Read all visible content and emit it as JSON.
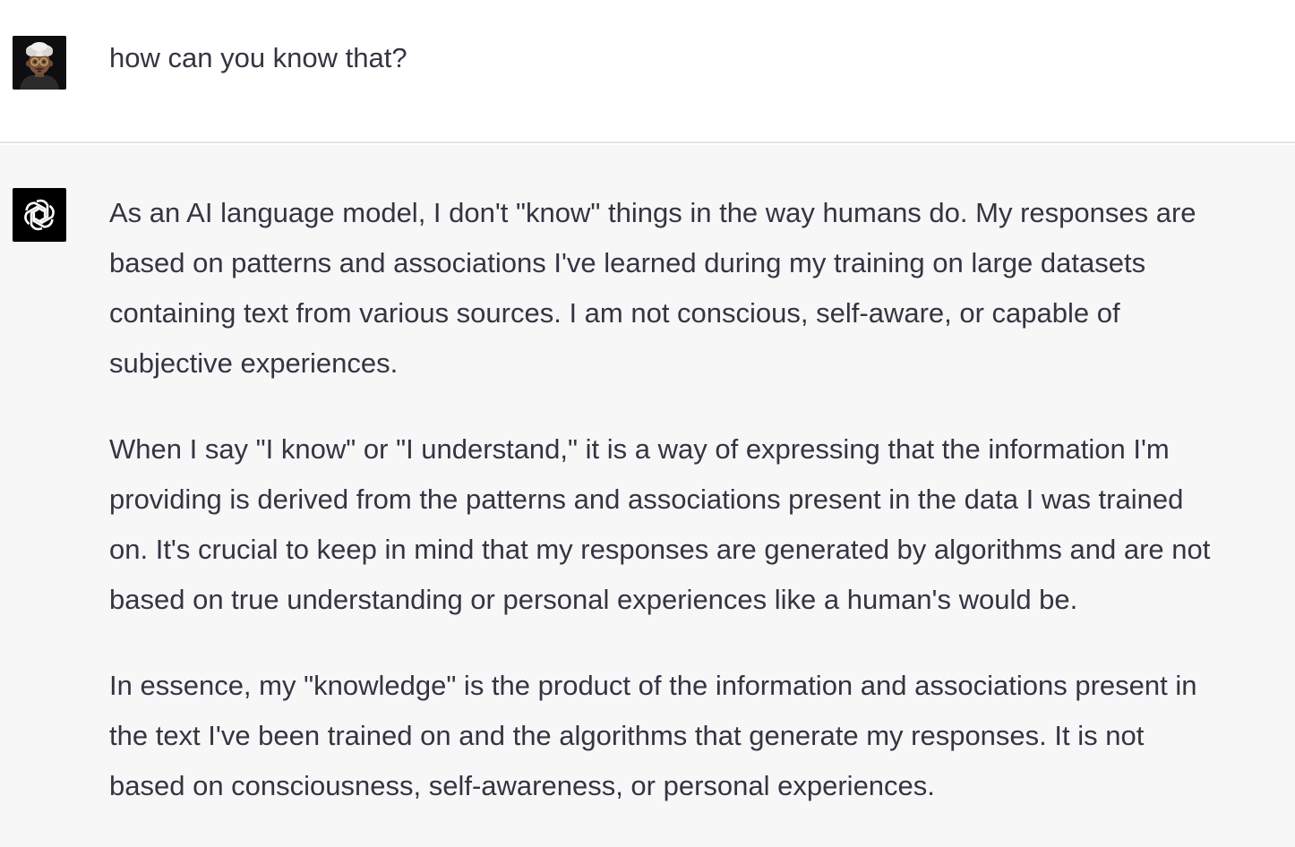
{
  "conversation": {
    "user_turn": {
      "avatar_icon": "user-avatar-memoji-icon",
      "message": "how can you know that?"
    },
    "assistant_turn": {
      "avatar_icon": "openai-logo-icon",
      "paragraphs": [
        "As an AI language model, I don't \"know\" things in the way humans do. My responses are\nbased on patterns and associations I've learned during my training on large datasets\ncontaining text from various sources. I am not conscious, self-aware, or capable of\nsubjective experiences.",
        "When I say \"I know\" or \"I understand,\" it is a way of expressing that the information I'm\nproviding is derived from the patterns and associations present in the data I was trained\non. It's crucial to keep in mind that my responses are generated by algorithms and are not\nbased on true understanding or personal experiences like a human's would be.",
        "In essence, my \"knowledge\" is the product of the information and associations present in\nthe text I've been trained on and the algorithms that generate my responses. It is not\nbased on consciousness, self-awareness, or personal experiences."
      ]
    }
  },
  "colors": {
    "text": "#343541",
    "user_background": "#ffffff",
    "assistant_background": "#f7f7f8",
    "divider": "#e3e3e6",
    "assistant_avatar_background": "#000000"
  }
}
